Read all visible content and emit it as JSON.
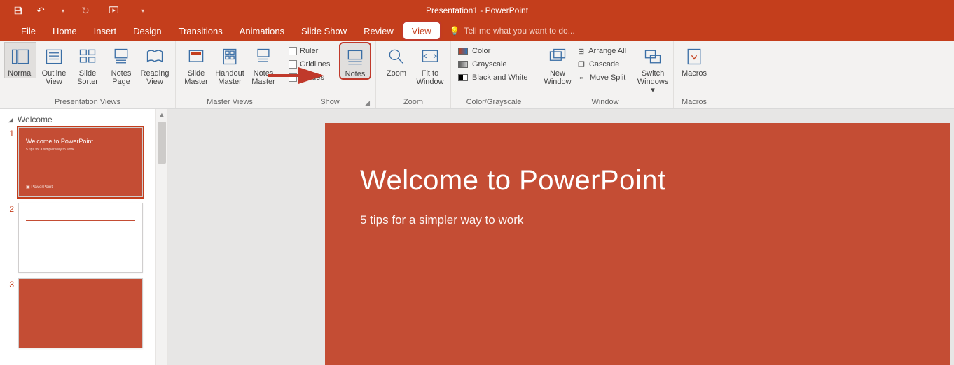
{
  "window": {
    "title": "Presentation1 - PowerPoint"
  },
  "qat": {
    "save": "save-icon",
    "undo": "undo-icon",
    "redo": "redo-icon",
    "start": "start-from-beginning-icon"
  },
  "tabs": {
    "file": "File",
    "home": "Home",
    "insert": "Insert",
    "design": "Design",
    "transitions": "Transitions",
    "animations": "Animations",
    "slideshow": "Slide Show",
    "review": "Review",
    "view": "View"
  },
  "tellme": {
    "placeholder": "Tell me what you want to do..."
  },
  "ribbon": {
    "presentation_views": {
      "label": "Presentation Views",
      "normal": "Normal",
      "outline": "Outline View",
      "sorter": "Slide Sorter",
      "notes_page": "Notes Page",
      "reading": "Reading View"
    },
    "master_views": {
      "label": "Master Views",
      "slide": "Slide Master",
      "handout": "Handout Master",
      "notes": "Notes Master"
    },
    "show": {
      "label": "Show",
      "ruler": "Ruler",
      "gridlines": "Gridlines",
      "guides": "Guides",
      "notes": "Notes"
    },
    "zoom": {
      "label": "Zoom",
      "zoom": "Zoom",
      "fit": "Fit to Window"
    },
    "color": {
      "label": "Color/Grayscale",
      "color": "Color",
      "gray": "Grayscale",
      "bw": "Black and White"
    },
    "window": {
      "label": "Window",
      "new": "New Window",
      "arrange": "Arrange All",
      "cascade": "Cascade",
      "split": "Move Split",
      "switch": "Switch Windows"
    },
    "macros": {
      "label": "Macros",
      "macros": "Macros"
    }
  },
  "sidepanel": {
    "section": "Welcome",
    "slides": [
      {
        "num": "1",
        "title": "Welcome to PowerPoint",
        "sub": "5 tips for a simpler way to work"
      },
      {
        "num": "2"
      },
      {
        "num": "3"
      }
    ]
  },
  "slide": {
    "title": "Welcome to PowerPoint",
    "subtitle": "5 tips for a simpler way to work"
  }
}
